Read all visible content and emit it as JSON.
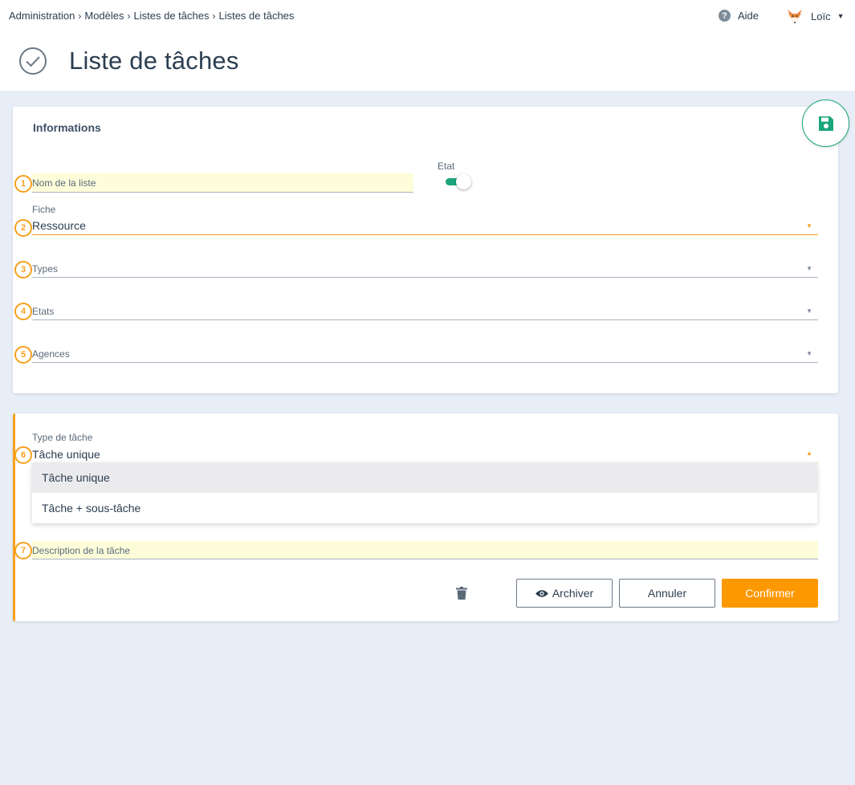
{
  "breadcrumb": {
    "items": [
      "Administration",
      "Modèles",
      "Listes de tâches"
    ],
    "current": "Listes de tâches",
    "separator": "›"
  },
  "header": {
    "help_label": "Aide",
    "user_name": "Loïc",
    "page_title": "Liste de tâches"
  },
  "informations": {
    "title": "Informations",
    "nom_label": "Nom de la liste",
    "etat_label": "Etat",
    "etat_on": true,
    "fiche_label": "Fiche",
    "fiche_value": "Ressource",
    "types_label": "Types",
    "etats_label": "Etats",
    "agences_label": "Agences"
  },
  "task": {
    "type_label": "Type de tâche",
    "type_value": "Tâche unique",
    "options": [
      "Tâche unique",
      "Tâche + sous-tâche"
    ],
    "description_label": "Description de la tâche",
    "archive_label": "Archiver",
    "cancel_label": "Annuler",
    "confirm_label": "Confirmer"
  },
  "markers": [
    "1",
    "2",
    "3",
    "4",
    "5",
    "6",
    "7"
  ],
  "colors": {
    "accent": "#f7a01d",
    "confirm": "#fd9800",
    "success": "#1aa57c",
    "background": "#e8eef7",
    "highlight": "#fdfdd9"
  }
}
